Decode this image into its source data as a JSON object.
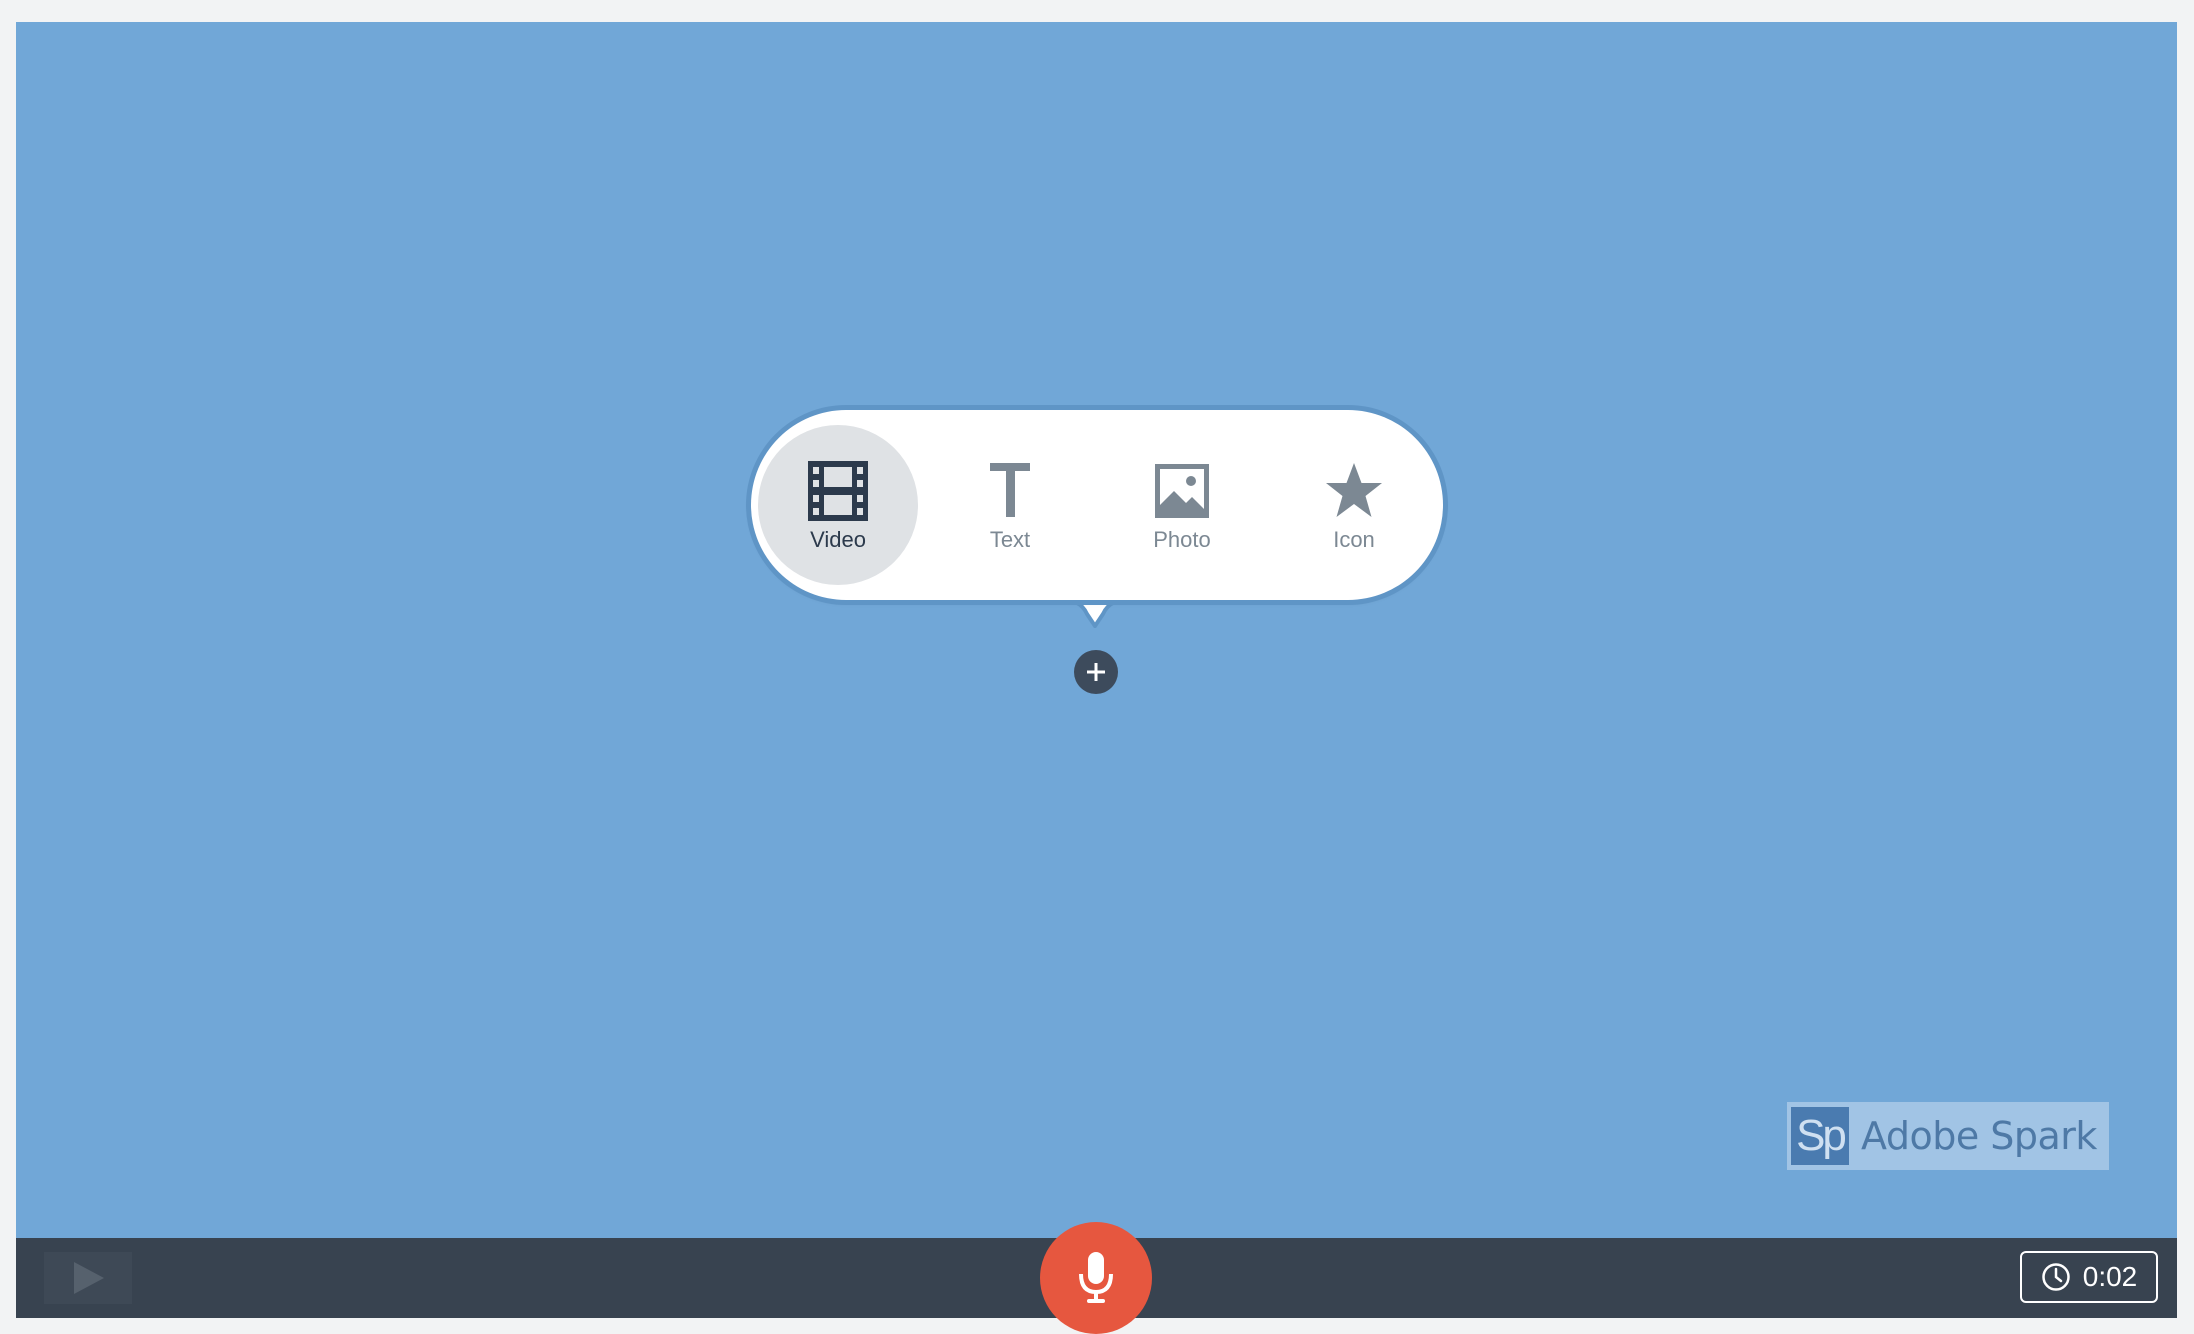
{
  "menu": {
    "items": [
      {
        "label": "Video",
        "icon": "film-icon",
        "selected": true
      },
      {
        "label": "Text",
        "icon": "text-icon",
        "selected": false
      },
      {
        "label": "Photo",
        "icon": "image-icon",
        "selected": false
      },
      {
        "label": "Icon",
        "icon": "star-icon",
        "selected": false
      }
    ]
  },
  "add_button": {
    "icon": "plus-icon"
  },
  "watermark": {
    "logo": "Sp",
    "text": "Adobe Spark"
  },
  "bottom_bar": {
    "play_icon": "play-icon",
    "mic_icon": "microphone-icon",
    "duration": "0:02",
    "duration_icon": "clock-icon"
  },
  "colors": {
    "stage_background": "#71a7d7",
    "bottom_bar": "#384350",
    "record_button": "#e6573f",
    "selected_item": "#dfe2e5"
  }
}
